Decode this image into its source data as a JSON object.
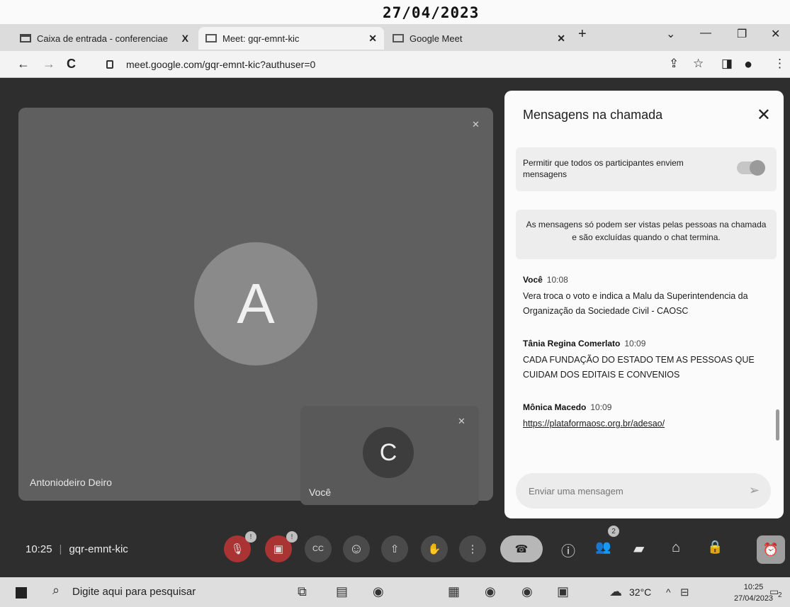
{
  "stamp": {
    "date": "27/04/2023"
  },
  "tabs": [
    {
      "label": "Caixa de entrada - conferenciae",
      "icon": "gmail-icon",
      "close": "X"
    },
    {
      "label": "Meet: gqr-emnt-kic",
      "icon": "meet-icon",
      "close": "✕"
    },
    {
      "label": "Google Meet",
      "icon": "meet-icon",
      "close": "✕"
    }
  ],
  "newtab": "+",
  "window_controls": {
    "chevron": "⌄",
    "minimize": "—",
    "restore": "❐",
    "close": "✕"
  },
  "address": {
    "url": "meet.google.com/gqr-emnt-kic?authuser=0",
    "back": "←",
    "forward": "→",
    "reload": "C"
  },
  "toolbar_icons": {
    "share": "⇪",
    "star": "☆",
    "sidepanel": "◨",
    "profile": "●",
    "menu": "⋮"
  },
  "main_tile": {
    "avatar_letter": "A",
    "name": "Antoniodeiro Deiro"
  },
  "self_tile": {
    "avatar_letter": "C",
    "name": "Você"
  },
  "chat": {
    "title": "Mensagens na chamada",
    "close": "✕",
    "permission_text": "Permitir que todos os participantes enviem mensagens",
    "notice": "As mensagens só podem ser vistas pelas pessoas na chamada e são excluídas quando o chat termina.",
    "messages": [
      {
        "sender": "Você",
        "time": "10:08",
        "text": "Vera troca o voto e indica a Malu da Superintendencia da Organização da Sociedade Civil - CAOSC"
      },
      {
        "sender": "Tânia Regina Comerlato",
        "time": "10:09",
        "text": "CADA FUNDAÇÃO DO ESTADO TEM AS PESSOAS QUE CUIDAM DOS EDITAIS E CONVENIOS"
      },
      {
        "sender": "Mônica Macedo",
        "time": "10:09",
        "link": "https://plataformaosc.org.br/adesao/"
      }
    ],
    "composer_placeholder": "Enviar uma mensagem",
    "send": "➢"
  },
  "meeting": {
    "time": "10:25",
    "separator": "|",
    "code": "gqr-emnt-kic",
    "participants_badge": "2"
  },
  "controls": {
    "captions": "CC",
    "emoji": "☺",
    "present": "⇧",
    "hand": "✋",
    "more": "⋮",
    "hangup": "☎",
    "info": "ⓘ",
    "people": "👥",
    "chat": "▰",
    "activities": "⌂",
    "lock": "🔒",
    "timer": "⏰"
  },
  "taskbar": {
    "search": "Digite aqui para pesquisar",
    "temperature": "32°C",
    "clock_time": "10:25",
    "clock_date": "27/04/2023",
    "notif": "2"
  }
}
